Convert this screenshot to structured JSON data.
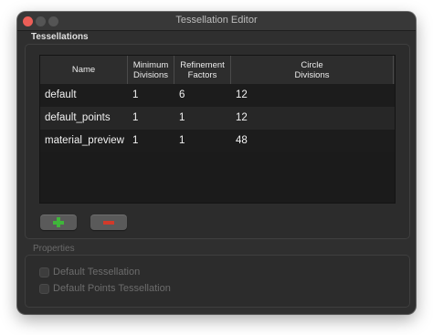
{
  "window": {
    "title": "Tessellation Editor"
  },
  "tessellations": {
    "group_label": "Tessellations",
    "columns": [
      "Name",
      "Minimum\nDivisions",
      "Refinement\nFactors",
      "Circle\nDivisions"
    ],
    "rows": [
      {
        "name": "default",
        "min_divisions": "1",
        "refinement": "6",
        "circle_divisions": "12"
      },
      {
        "name": "default_points",
        "min_divisions": "1",
        "refinement": "1",
        "circle_divisions": "12"
      },
      {
        "name": "material_preview",
        "min_divisions": "1",
        "refinement": "1",
        "circle_divisions": "48"
      }
    ],
    "add_button_icon": "plus-icon",
    "remove_button_icon": "minus-icon"
  },
  "properties": {
    "group_label": "Properties",
    "default_tessellation": {
      "label": "Default Tessellation",
      "checked": false,
      "enabled": false
    },
    "default_points_tessellation": {
      "label": "Default Points Tessellation",
      "checked": false,
      "enabled": false
    }
  },
  "colors": {
    "close_button": "#ec5e57",
    "add_icon": "#3fb53a",
    "remove_icon": "#d23a2a",
    "window_bg": "#2f2f2f"
  }
}
